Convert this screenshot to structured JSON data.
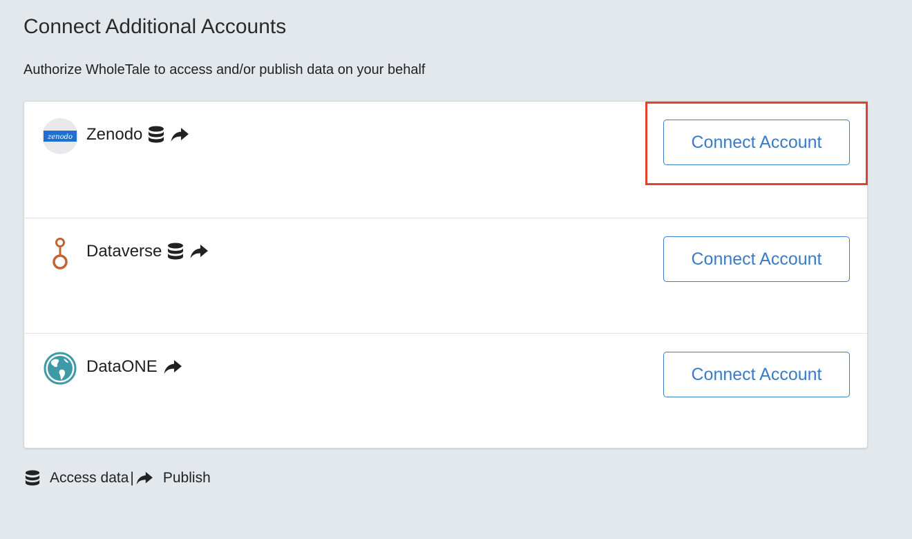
{
  "header": {
    "title": "Connect Additional Accounts",
    "subtitle": "Authorize WholeTale to access and/or publish data on your behalf"
  },
  "providers": [
    {
      "name": "Zenodo",
      "logo_text": "zenodo",
      "icons": [
        "database-icon",
        "share-icon"
      ],
      "button_label": "Connect Account"
    },
    {
      "name": "Dataverse",
      "icons": [
        "database-icon",
        "share-icon"
      ],
      "button_label": "Connect Account"
    },
    {
      "name": "DataONE",
      "icons": [
        "share-icon"
      ],
      "button_label": "Connect Account"
    }
  ],
  "legend": {
    "access_label": "Access data",
    "separator": "|",
    "publish_label": "Publish"
  },
  "colors": {
    "background": "#e2e8ec",
    "accent": "#3a7bc8",
    "highlight": "#e0432c",
    "zenodo_blue": "#1f6fd0",
    "dataverse_orange": "#c0652f",
    "dataone_teal": "#3e9aa6"
  }
}
